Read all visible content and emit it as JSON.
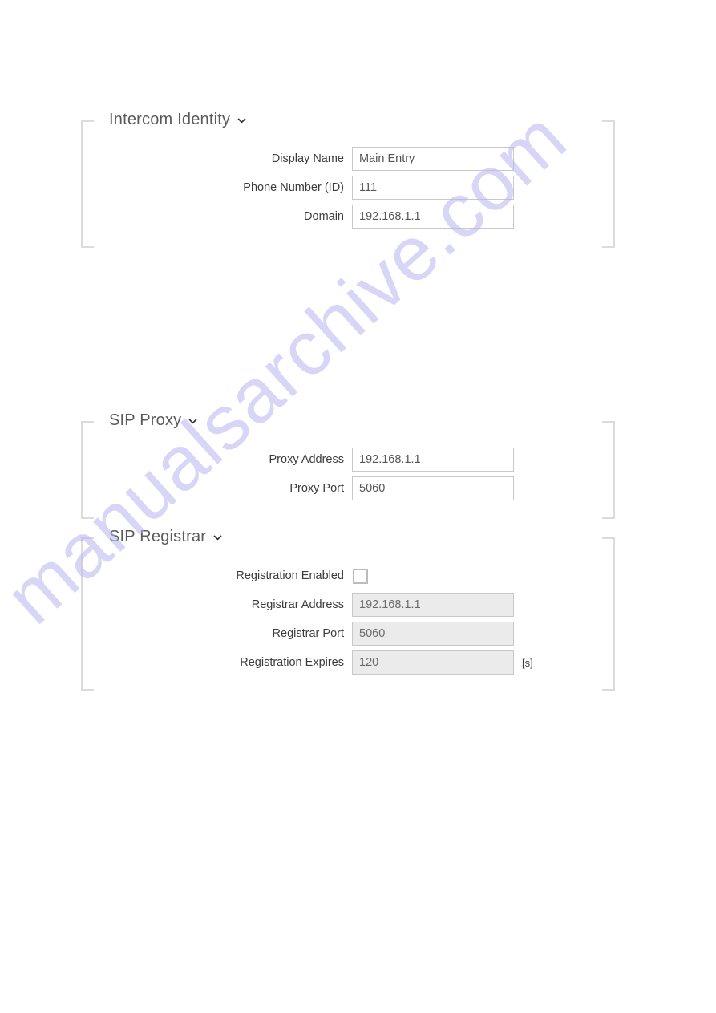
{
  "watermark": {
    "text": "manualsarchive.com"
  },
  "sections": [
    {
      "id": "intercom-identity",
      "title": "Intercom Identity",
      "toggle_icon": "chevron-down-icon",
      "rows": [
        {
          "label": "Display Name",
          "value": "Main Entry",
          "type": "text",
          "disabled": false
        },
        {
          "label": "Phone Number (ID)",
          "value": "111",
          "type": "text",
          "disabled": false
        },
        {
          "label": "Domain",
          "value": "192.168.1.1",
          "type": "text",
          "disabled": false
        }
      ]
    },
    {
      "id": "sip-proxy",
      "title": "SIP Proxy",
      "toggle_icon": "chevron-down-icon",
      "rows": [
        {
          "label": "Proxy Address",
          "value": "192.168.1.1",
          "type": "text",
          "disabled": false
        },
        {
          "label": "Proxy Port",
          "value": "5060",
          "type": "text",
          "disabled": false
        }
      ]
    },
    {
      "id": "sip-registrar",
      "title": "SIP Registrar",
      "toggle_icon": "chevron-down-icon",
      "rows": [
        {
          "label": "Registration Enabled",
          "value": "",
          "type": "checkbox",
          "checked": false
        },
        {
          "label": "Registrar Address",
          "value": "192.168.1.1",
          "type": "text",
          "disabled": true
        },
        {
          "label": "Registrar Port",
          "value": "5060",
          "type": "text",
          "disabled": true
        },
        {
          "label": "Registration Expires",
          "value": "120",
          "type": "text",
          "disabled": true,
          "unit": "[s]"
        }
      ]
    }
  ]
}
